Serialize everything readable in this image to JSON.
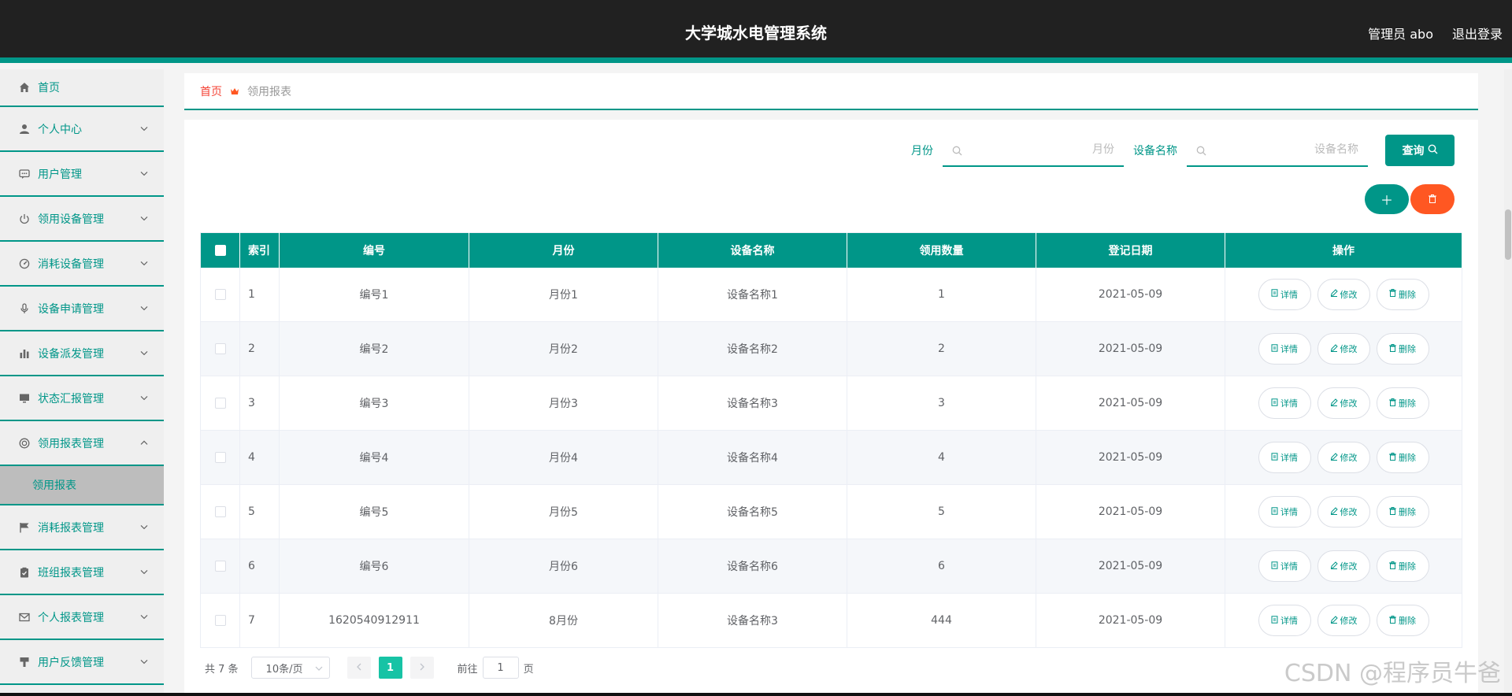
{
  "header": {
    "title": "大学城水电管理系统",
    "user": "管理员 abo",
    "logout": "退出登录"
  },
  "sidebar": {
    "home": "首页",
    "items": [
      {
        "label": "个人中心",
        "icon": "user-icon"
      },
      {
        "label": "用户管理",
        "icon": "chat-icon"
      },
      {
        "label": "领用设备管理",
        "icon": "power-icon"
      },
      {
        "label": "消耗设备管理",
        "icon": "gauge-icon"
      },
      {
        "label": "设备申请管理",
        "icon": "mic-icon"
      },
      {
        "label": "设备派发管理",
        "icon": "bar-chart-icon"
      },
      {
        "label": "状态汇报管理",
        "icon": "monitor-icon"
      },
      {
        "label": "领用报表管理",
        "icon": "circle-icon"
      },
      {
        "label": "消耗报表管理",
        "icon": "flag-icon"
      },
      {
        "label": "班组报表管理",
        "icon": "clipboard-icon"
      },
      {
        "label": "个人报表管理",
        "icon": "mail-icon"
      },
      {
        "label": "用户反馈管理",
        "icon": "brush-icon"
      }
    ],
    "submenu": "领用报表"
  },
  "breadcrumb": {
    "home": "首页",
    "current": "领用报表"
  },
  "search": {
    "month_label": "月份",
    "month_placeholder": "月份",
    "device_label": "设备名称",
    "device_placeholder": "设备名称",
    "query": "查询"
  },
  "table": {
    "headers": [
      "索引",
      "编号",
      "月份",
      "设备名称",
      "领用数量",
      "登记日期",
      "操作"
    ],
    "rows": [
      [
        "1",
        "编号1",
        "月份1",
        "设备名称1",
        "1",
        "2021-05-09"
      ],
      [
        "2",
        "编号2",
        "月份2",
        "设备名称2",
        "2",
        "2021-05-09"
      ],
      [
        "3",
        "编号3",
        "月份3",
        "设备名称3",
        "3",
        "2021-05-09"
      ],
      [
        "4",
        "编号4",
        "月份4",
        "设备名称4",
        "4",
        "2021-05-09"
      ],
      [
        "5",
        "编号5",
        "月份5",
        "设备名称5",
        "5",
        "2021-05-09"
      ],
      [
        "6",
        "编号6",
        "月份6",
        "设备名称6",
        "6",
        "2021-05-09"
      ],
      [
        "7",
        "1620540912911",
        "8月份",
        "设备名称3",
        "444",
        "2021-05-09"
      ]
    ],
    "ops": {
      "detail": "详情",
      "edit": "修改",
      "delete": "删除"
    }
  },
  "pager": {
    "total": "共 7 条",
    "size": "10条/页",
    "current": "1",
    "goto_prefix": "前往",
    "goto_value": "1",
    "goto_suffix": "页"
  },
  "watermark": "CSDN @程序员牛爸",
  "colors": {
    "accent": "#009688",
    "danger": "#ff5722",
    "header_bg": "#212121",
    "page_active": "#17c3a5"
  }
}
